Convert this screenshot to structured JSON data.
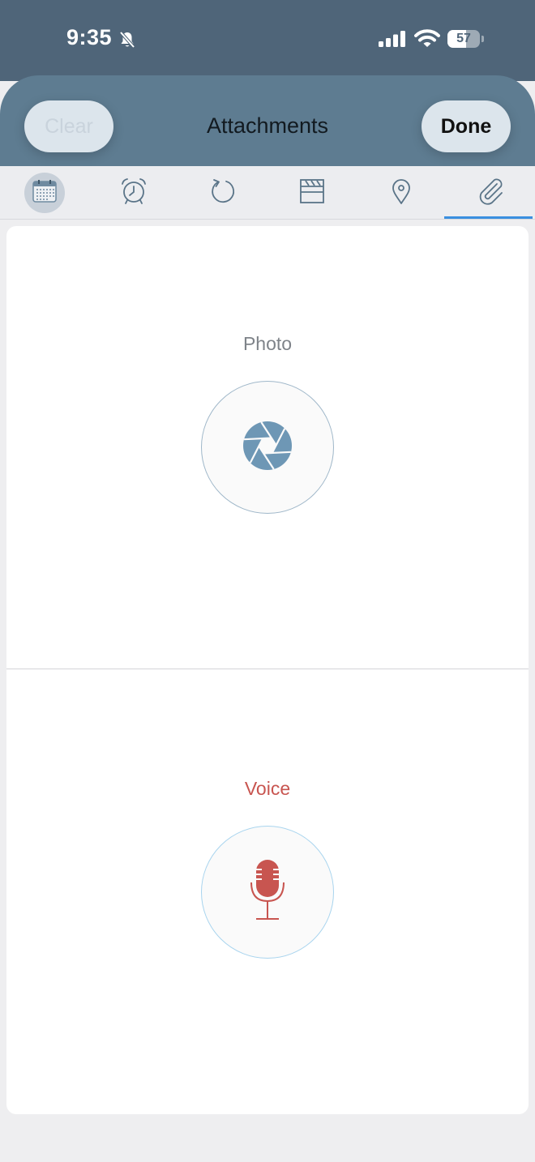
{
  "status_bar": {
    "time": "9:35",
    "battery": "57",
    "icons": [
      "bell-slash-icon",
      "cellular-signal-icon",
      "wifi-icon",
      "battery-icon"
    ]
  },
  "header": {
    "title": "Attachments",
    "clear_label": "Clear",
    "done_label": "Done"
  },
  "tabs": [
    {
      "name": "calendar",
      "icon": "calendar-icon",
      "selected_background": true
    },
    {
      "name": "alarm",
      "icon": "alarm-clock-icon"
    },
    {
      "name": "repeat",
      "icon": "repeat-icon"
    },
    {
      "name": "clapperboard",
      "icon": "clapperboard-icon"
    },
    {
      "name": "location",
      "icon": "location-pin-icon"
    },
    {
      "name": "attachments",
      "icon": "paperclip-icon",
      "active": true
    }
  ],
  "sections": {
    "photo": {
      "label": "Photo",
      "icon": "camera-aperture-icon"
    },
    "voice": {
      "label": "Voice",
      "icon": "microphone-icon"
    }
  },
  "colors": {
    "header_bg": "#5e7c91",
    "status_bg": "#4f6579",
    "accent_blue": "#3a8fe0",
    "photo_icon": "#6e97b5",
    "voice_red": "#c85550"
  }
}
